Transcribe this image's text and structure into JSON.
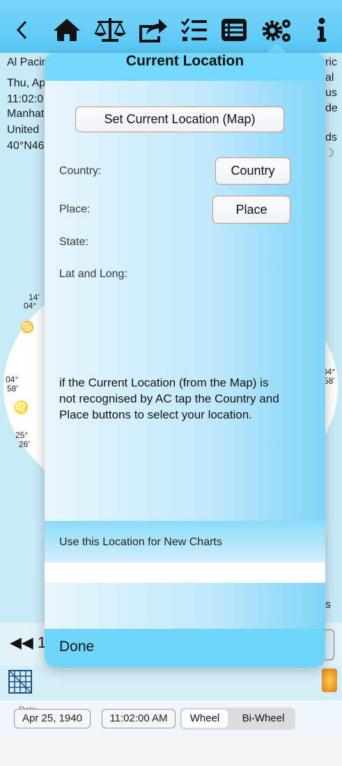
{
  "toolbar": {
    "icons": [
      "back-chevron-icon",
      "home-icon",
      "balance-scale-icon",
      "share-icon",
      "checklist-icon",
      "list-icon",
      "settings-gears-icon",
      "info-icon"
    ],
    "accent": "#5cc8f5"
  },
  "background": {
    "left_lines": [
      "Al Pacin",
      "Thu, Ap",
      "11:02:0",
      "Manhat",
      "United",
      "40°N46"
    ],
    "right_lines": [
      "ric",
      "al",
      "us",
      "de",
      "ds"
    ],
    "chart_labels": {
      "a": "14'",
      "b": "04°",
      "c": "04°",
      "d": "58'",
      "e": "25°",
      "f": "26'",
      "g": "04°",
      "h": "58'"
    },
    "nav_fragment": "1",
    "status_fields": {
      "date_label": "Date",
      "date": "Apr 25, 1940",
      "time": "11:02:00 AM",
      "wheel": "Wheel",
      "biwheel": "Bi-Wheel"
    },
    "right_fragment": "s"
  },
  "popover": {
    "title": "Current Location",
    "set_location_button": "Set Current Location (Map)",
    "country_label": "Country:",
    "country_button": "Country",
    "place_label": "Place:",
    "place_button": "Place",
    "state_label": "State:",
    "latlong_label": "Lat and Long:",
    "hint": "if the Current Location (from the Map) is not recognised by AC tap the Country and Place buttons to select your location.",
    "use_location_label": "Use this Location for New Charts",
    "done_label": "Done"
  }
}
